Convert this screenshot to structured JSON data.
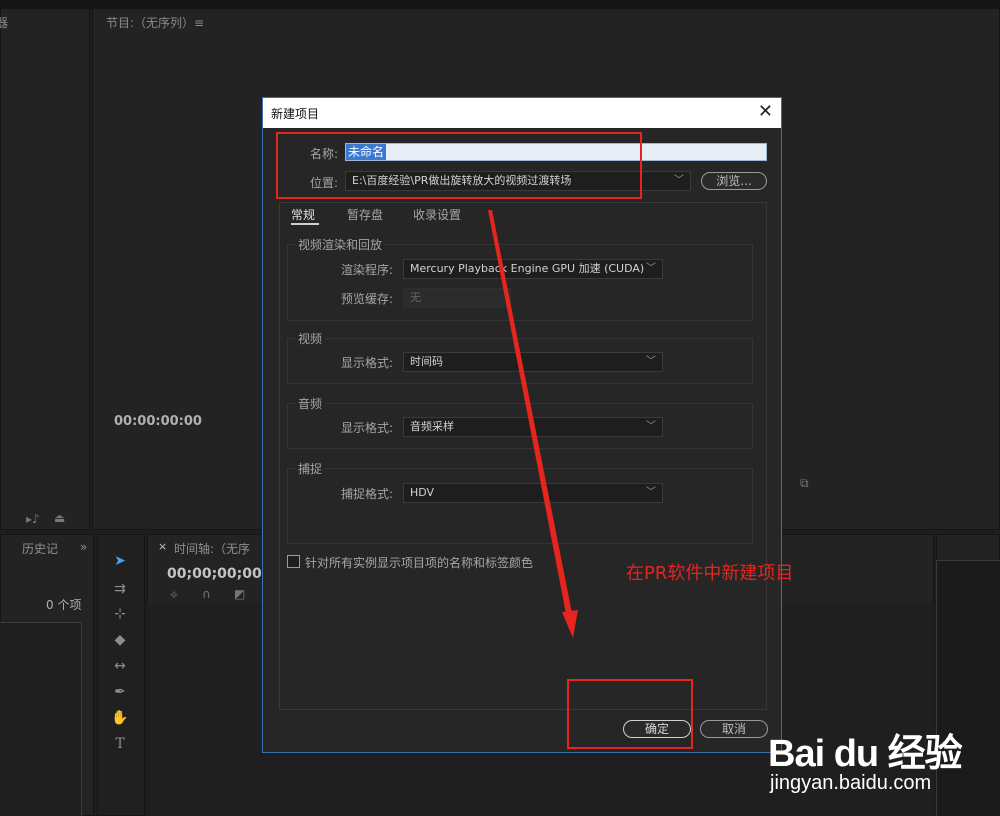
{
  "app": {
    "left_panel_fragment": "器",
    "program_title": "节目:（无序列）≡",
    "program_timecode": "00:00:00:00",
    "history_tab": "历史记",
    "history_more": "»",
    "history_count": "0 个项",
    "timeline_close": "×",
    "timeline_tab": "时间轴:（无序",
    "timeline_timecode": "00;00;00;00"
  },
  "dialog": {
    "title": "新建项目",
    "close_glyph": "✕",
    "name_label": "名称:",
    "name_value": "未命名",
    "location_label": "位置:",
    "location_value": "E:\\百度经验\\PR做出旋转放大的视频过渡转场",
    "browse_label": "浏览...",
    "tabs": [
      "常规",
      "暂存盘",
      "收录设置"
    ],
    "groups": {
      "render": {
        "title": "视频渲染和回放",
        "renderer_label": "渲染程序:",
        "renderer_value": "Mercury Playback Engine GPU 加速 (CUDA)",
        "preview_cache_label": "预览缓存:",
        "preview_cache_value": "无"
      },
      "video": {
        "title": "视频",
        "display_format_label": "显示格式:",
        "display_format_value": "时间码"
      },
      "audio": {
        "title": "音频",
        "display_format_label": "显示格式:",
        "display_format_value": "音频采样"
      },
      "capture": {
        "title": "捕捉",
        "capture_format_label": "捕捉格式:",
        "capture_format_value": "HDV"
      }
    },
    "checkbox_label": "针对所有实例显示项目项的名称和标签颜色",
    "ok_label": "确定",
    "cancel_label": "取消"
  },
  "annotation": {
    "text": "在PR软件中新建项目",
    "color": "#e5251e"
  },
  "watermark": {
    "brand": "Bai du 经验",
    "url": "jingyan.baidu.com"
  }
}
